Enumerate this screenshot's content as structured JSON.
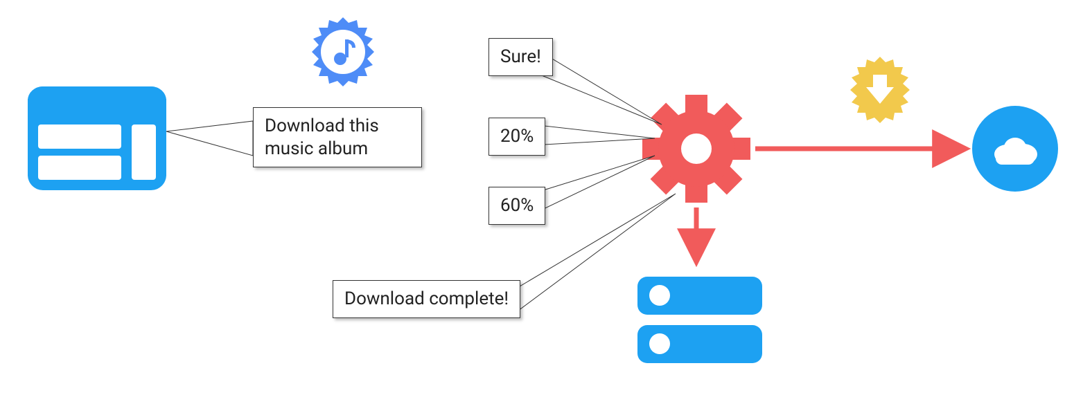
{
  "request": {
    "label": "Download this\nmusic album"
  },
  "responses": {
    "ack": "Sure!",
    "progress1": "20%",
    "progress2": "60%",
    "done": "Download complete!"
  },
  "colors": {
    "blue": "#1DA1F2",
    "seal_blue": "#4E8CF7",
    "red": "#F15B5B",
    "yellow": "#F2C94C",
    "white": "#FFFFFF",
    "black": "#333333"
  },
  "entities": {
    "client": "browser-window-icon",
    "request_badge": "music-note-seal-icon",
    "worker": "gear-icon",
    "download_badge": "download-arrow-seal-icon",
    "cloud": "cloud-circle-icon",
    "storage": "server-stack-icon"
  }
}
